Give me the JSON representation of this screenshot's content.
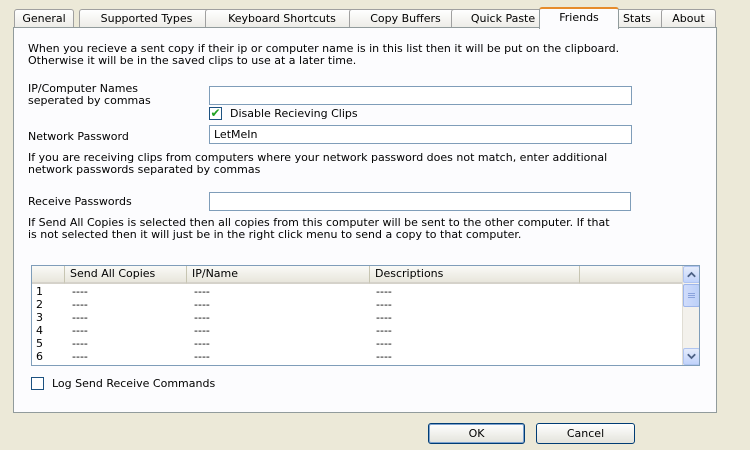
{
  "tabs": [
    {
      "label": "General"
    },
    {
      "label": "Supported Types"
    },
    {
      "label": "Keyboard Shortcuts"
    },
    {
      "label": "Copy Buffers"
    },
    {
      "label": "Quick Paste"
    },
    {
      "label": "Friends",
      "active": true
    },
    {
      "label": "Stats"
    },
    {
      "label": "About"
    }
  ],
  "friends": {
    "intro_line1": "When you recieve a sent copy if their ip or computer name is in this list then it will be put on the clipboard.",
    "intro_line2": "Otherwise it will be in the saved clips to use at a later time.",
    "ip_label_line1": "IP/Computer Names",
    "ip_label_line2": "seperated by commas",
    "ip_value": "",
    "disable_receiving_label": "Disable Recieving Clips",
    "disable_receiving_checked": true,
    "network_password_label": "Network Password",
    "network_password_value": "LetMeIn",
    "password_note_line1": "If you are receiving clips from computers where your network password does not match, enter additional",
    "password_note_line2": "network passwords separated by commas",
    "receive_passwords_label": "Receive Passwords",
    "receive_passwords_value": "",
    "send_note_line1": "If Send All Copies is selected then all copies from this computer will be sent to the other computer.  If that",
    "send_note_line2": "is not selected then it will just be in the right click menu to send a copy to that computer.",
    "table": {
      "columns": [
        "",
        "Send All Copies",
        "IP/Name",
        "Descriptions",
        ""
      ],
      "rows": [
        {
          "num": "1",
          "send": "----",
          "ip": "----",
          "desc": "----"
        },
        {
          "num": "2",
          "send": "----",
          "ip": "----",
          "desc": "----"
        },
        {
          "num": "3",
          "send": "----",
          "ip": "----",
          "desc": "----"
        },
        {
          "num": "4",
          "send": "----",
          "ip": "----",
          "desc": "----"
        },
        {
          "num": "5",
          "send": "----",
          "ip": "----",
          "desc": "----"
        },
        {
          "num": "6",
          "send": "----",
          "ip": "----",
          "desc": "----"
        }
      ]
    },
    "log_label": "Log Send Receive Commands",
    "log_checked": false
  },
  "buttons": {
    "ok": "OK",
    "cancel": "Cancel"
  },
  "icons": {
    "check": "checkmark-icon",
    "scroll_up": "chevron-up-icon",
    "scroll_down": "chevron-down-icon"
  },
  "colors": {
    "dialog_bg": "#ece9d8",
    "panel_bg": "#fcfcfe",
    "active_tab_accent": "#e68b2c",
    "input_border": "#7f9db9",
    "check_color": "#21a121"
  }
}
